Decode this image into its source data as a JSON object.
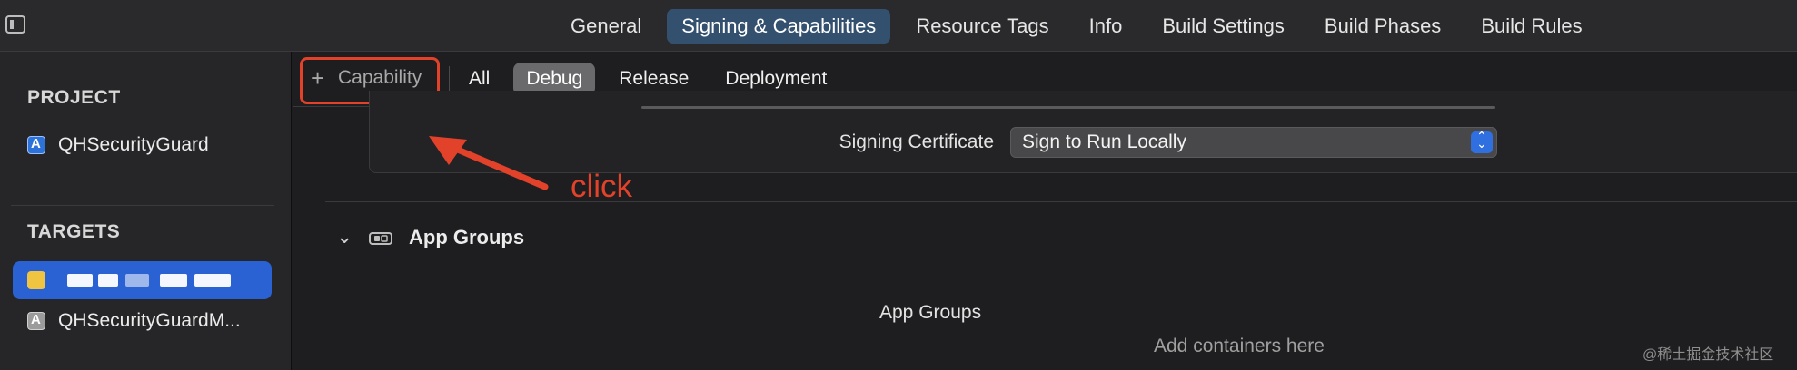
{
  "tabs": [
    {
      "label": "General"
    },
    {
      "label": "Signing & Capabilities",
      "active": true
    },
    {
      "label": "Resource Tags"
    },
    {
      "label": "Info"
    },
    {
      "label": "Build Settings"
    },
    {
      "label": "Build Phases"
    },
    {
      "label": "Build Rules"
    }
  ],
  "sidebar": {
    "project_heading": "PROJECT",
    "project_item": "QHSecurityGuard",
    "targets_heading": "TARGETS",
    "target_items": [
      "QHSecurityGuardM..."
    ]
  },
  "toolbar": {
    "capability_label": "Capability",
    "filters": [
      "All",
      "Debug",
      "Release",
      "Deployment"
    ],
    "active_filter": "Debug"
  },
  "signing": {
    "label": "Signing Certificate",
    "value": "Sign to Run Locally"
  },
  "annotation": {
    "text": "click",
    "color": "#e2412a"
  },
  "app_groups": {
    "title": "App Groups",
    "list_title": "App Groups",
    "empty_text": "Add containers here"
  },
  "watermark": "@稀土掘金技术社区",
  "colors": {
    "accent": "#33516f",
    "selection": "#2b62d3",
    "annotation": "#e2412a"
  }
}
